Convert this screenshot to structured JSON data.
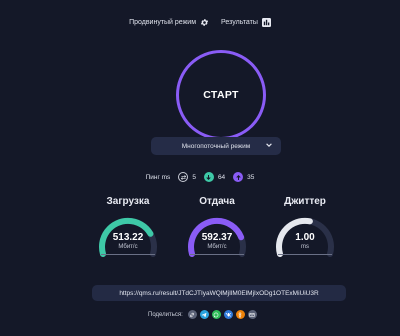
{
  "topbar": {
    "advanced_mode_label": "Продвинутый режим",
    "advanced_mode_icon": "gear-icon",
    "results_label": "Результаты",
    "results_icon": "bar-chart-icon"
  },
  "start_button": {
    "label": "СТАРТ",
    "ring_color": "#8a5cf6"
  },
  "mode_select": {
    "selected": "Многопоточный режим"
  },
  "pings": {
    "label": "Пинг ms",
    "items": [
      {
        "icon": "swap-icon",
        "value": "5"
      },
      {
        "icon": "download-arrow-icon",
        "value": "64",
        "color": "#3ec9a7"
      },
      {
        "icon": "upload-arrow-icon",
        "value": "35",
        "color": "#8a5cf6"
      }
    ]
  },
  "gauges": [
    {
      "title": "Загрузка",
      "value": "513.22",
      "unit": "Мбит/с",
      "color": "#3ec9a7",
      "fill": 0.78
    },
    {
      "title": "Отдача",
      "value": "592.37",
      "unit": "Мбит/с",
      "color": "#8a5cf6",
      "fill": 0.82
    },
    {
      "title": "Джиттер",
      "value": "1.00",
      "unit": "ms",
      "color": "#e6e8ee",
      "fill": 0.55
    }
  ],
  "result_url": "https://qms.ru/result/JTdCJTIyaWQlMjIlM0ElMjIxODg1OTExMiUiU3R",
  "share": {
    "label": "Поделиться:",
    "icons": [
      {
        "name": "link-icon",
        "color": "#5c6378"
      },
      {
        "name": "telegram-icon",
        "color": "#2aa3df"
      },
      {
        "name": "whatsapp-icon",
        "color": "#2fbf5a"
      },
      {
        "name": "vk-icon",
        "color": "#2f78d8"
      },
      {
        "name": "odnoklassniki-icon",
        "color": "#ee8208"
      },
      {
        "name": "mail-icon",
        "color": "#5c6378"
      }
    ]
  }
}
